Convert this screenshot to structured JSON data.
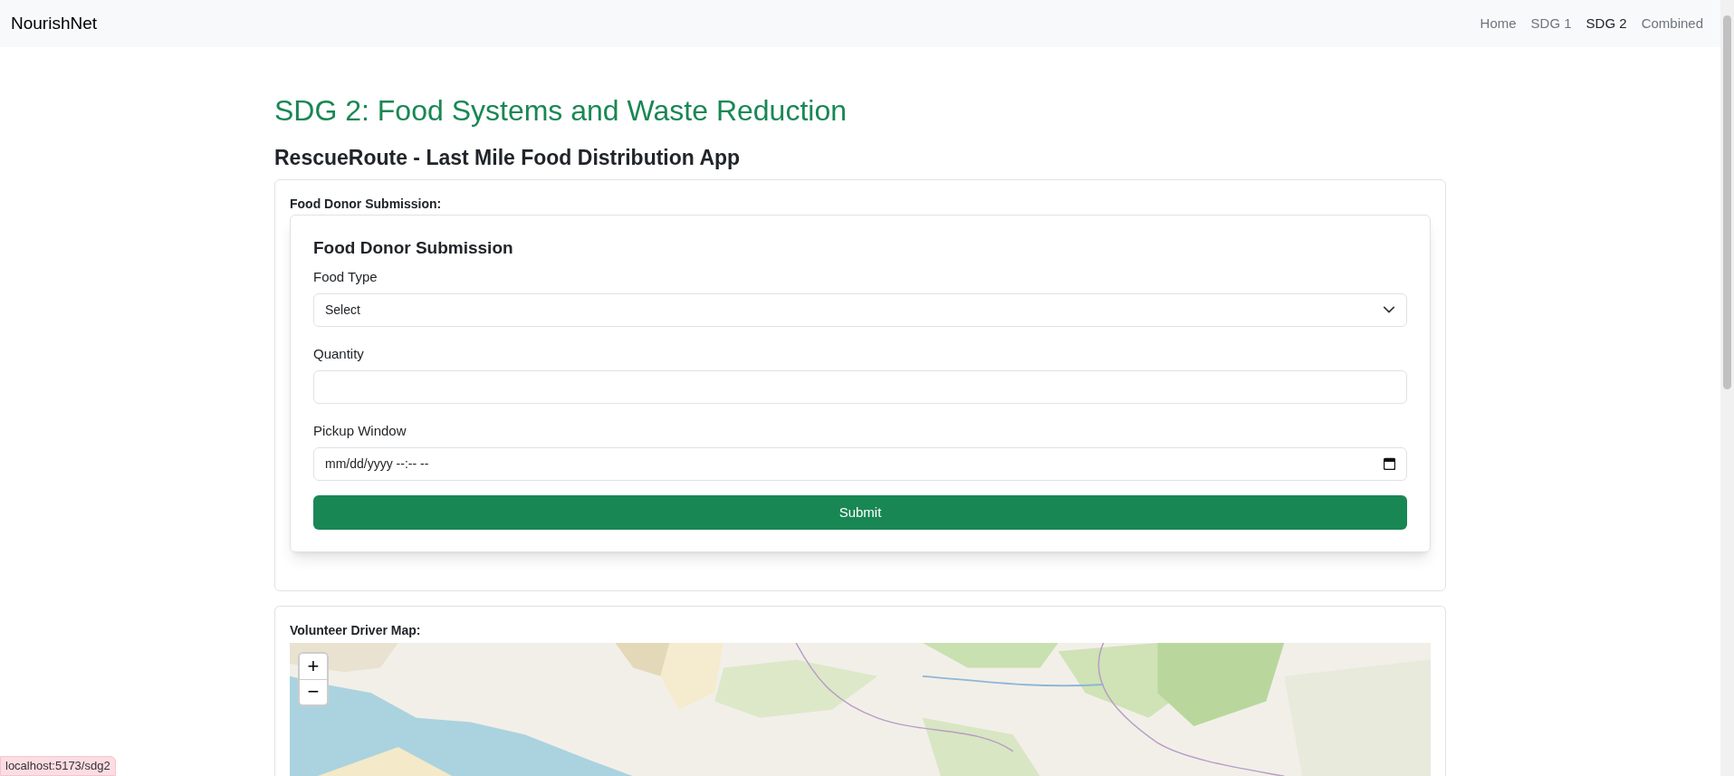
{
  "navbar": {
    "brand": "NourishNet",
    "links": [
      {
        "label": "Home",
        "selected": false
      },
      {
        "label": "SDG 1",
        "selected": false
      },
      {
        "label": "SDG 2",
        "selected": true
      },
      {
        "label": "Combined",
        "selected": false
      }
    ]
  },
  "heading": "SDG 2: Food Systems and Waste Reduction",
  "subheading": "RescueRoute - Last Mile Food Distribution App",
  "donor_section": {
    "label": "Food Donor Submission:",
    "form": {
      "title": "Food Donor Submission",
      "fields": [
        {
          "kind": "select",
          "label": "Food Type",
          "value": "Select"
        },
        {
          "kind": "text",
          "label": "Quantity"
        },
        {
          "kind": "datetime",
          "label": "Pickup Window",
          "placeholder": "mm/dd/yyyy --:-- --"
        }
      ],
      "submit": "Submit"
    }
  },
  "map_section": {
    "label": "Volunteer Driver Map:",
    "map": {
      "kind": "picture"
    },
    "zoom_controls": [
      "+",
      "−"
    ]
  },
  "status_bar": "localhost:5173/sdg2"
}
